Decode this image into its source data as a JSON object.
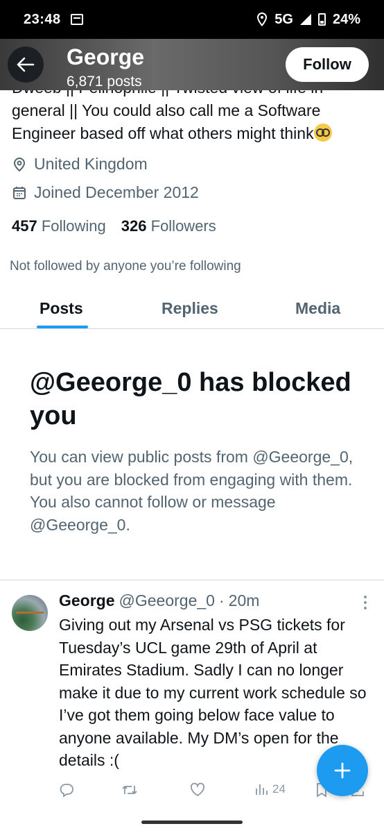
{
  "status_bar": {
    "time": "23:48",
    "network": "5G",
    "battery": "24%"
  },
  "header": {
    "name": "George",
    "posts": "6,871 posts",
    "follow_label": "Follow"
  },
  "bio": {
    "partial_line": "Dweeb || Pelinophile || Twisted view of life in",
    "lines": "general || You could also call me a Software Engineer based off what others might think"
  },
  "location": "United Kingdom",
  "joined": "Joined December 2012",
  "counts": {
    "following_num": "457",
    "following_label": "Following",
    "followers_num": "326",
    "followers_label": "Followers"
  },
  "not_followed": "Not followed by anyone you’re following",
  "tabs": [
    {
      "label": "Posts"
    },
    {
      "label": "Replies"
    },
    {
      "label": "Media"
    }
  ],
  "blocked": {
    "title": "@Geeorge_0 has blocked you",
    "body": "You can view public posts from @Geeorge_0, but you are blocked from engaging with them. You also cannot follow or message @Geeorge_0."
  },
  "tweet": {
    "name": "George",
    "handle": "@Geeorge_0",
    "dot": "·",
    "time": "20m",
    "text": "Giving out my Arsenal vs PSG tickets for Tuesday’s UCL game 29th of April at Emirates Stadium. Sadly I can no longer make it due to my current work schedule so I’ve got them going below face value to anyone available. My DM’s open for the details :(",
    "views": "24"
  },
  "icons": {
    "back": "arrow-left-icon",
    "location": "location-pin-icon",
    "calendar": "calendar-icon",
    "reply": "reply-icon",
    "retweet": "retweet-icon",
    "like": "heart-icon",
    "views": "views-icon",
    "bookmark": "bookmark-icon",
    "share": "share-icon",
    "compose": "plus-icon",
    "more": "more-vertical-icon"
  },
  "colors": {
    "accent": "#1d9bf0",
    "text_primary": "#0f1419",
    "text_secondary": "#536471"
  }
}
